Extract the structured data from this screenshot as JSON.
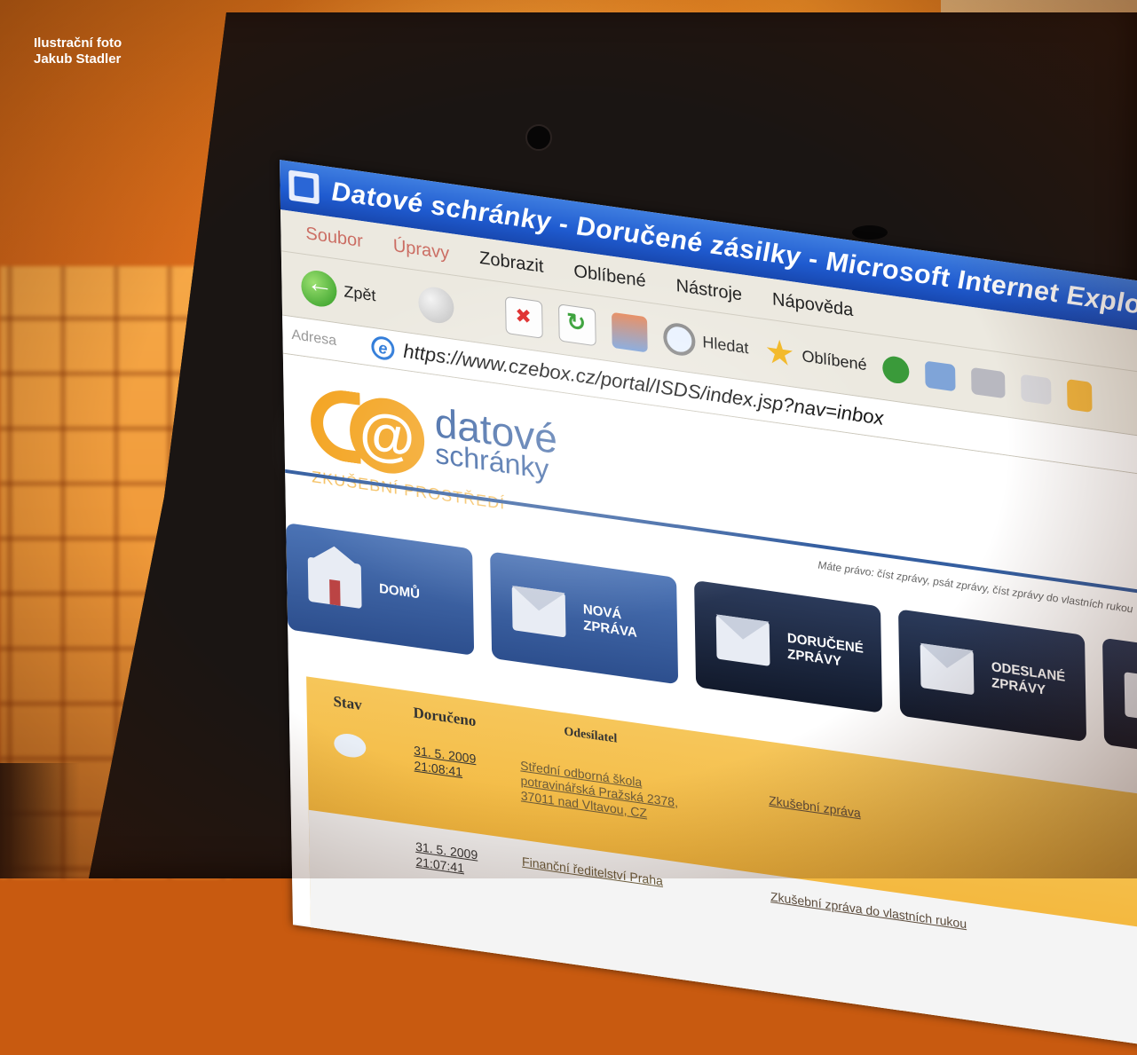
{
  "photo_credit": {
    "line1": "Ilustrační foto",
    "line2": "Jakub Stadler"
  },
  "browser": {
    "title": "Datové schránky - Doručené zásilky - Microsoft Internet Explorer",
    "menu": [
      "Soubor",
      "Úpravy",
      "Zobrazit",
      "Oblíbené",
      "Nástroje",
      "Nápověda"
    ],
    "toolbar": {
      "back_label": "Zpět",
      "search_label": "Hledat",
      "favorites_label": "Oblíbené"
    },
    "address_label": "Adresa",
    "url": "https://www.czebox.cz/portal/ISDS/index.jsp?nav=inbox"
  },
  "site": {
    "logo_line1": "datové",
    "logo_line2": "schránky",
    "logo_line3": "ZKUŠEBNÍ PROSTŘEDÍ",
    "rights_text": "Máte právo: číst zprávy, psát zprávy, číst zprávy do vlastních rukou",
    "nav": [
      {
        "line1": "DOMŮ",
        "line2": ""
      },
      {
        "line1": "NOVÁ",
        "line2": "ZPRÁVA"
      },
      {
        "line1": "DORUČENÉ",
        "line2": "ZPRÁVY"
      },
      {
        "line1": "ODESLANÉ",
        "line2": "ZPRÁVY"
      }
    ],
    "table": {
      "headers": {
        "state": "Stav",
        "delivered": "Doručeno",
        "sender": "Odesílatel"
      },
      "rows": [
        {
          "date": "31. 5. 2009",
          "time": "21:08:41",
          "sender": "Střední odborná škola potravinářská Pražská 2378, 37011 nad Vltavou, CZ",
          "subject": "Zkušební zpráva"
        },
        {
          "date": "31. 5. 2009",
          "time": "21:07:41",
          "sender": "Finanční ředitelství Praha",
          "subject": "Zkušební zpráva do vlastních rukou"
        }
      ]
    }
  }
}
